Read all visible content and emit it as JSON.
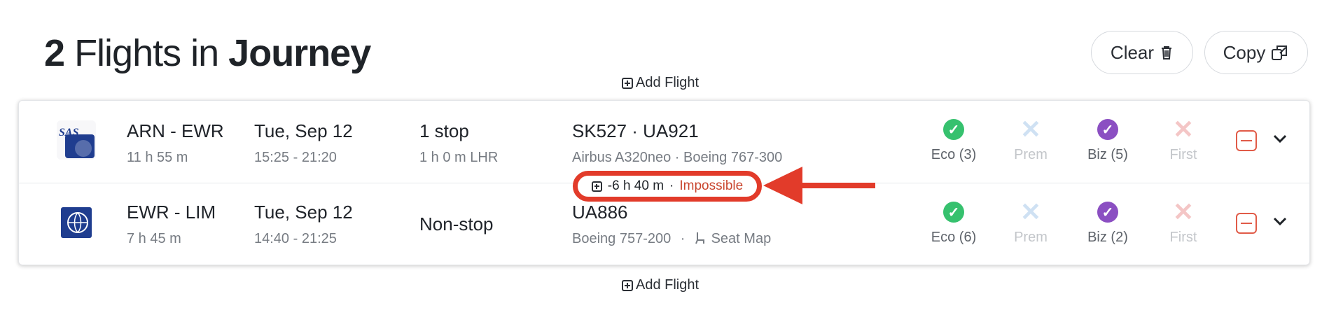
{
  "header": {
    "count": "2",
    "title_mid": "Flights in",
    "title_end": "Journey",
    "clear_label": "Clear",
    "copy_label": "Copy"
  },
  "add_flight_label": "Add Flight",
  "flights": [
    {
      "route": "ARN - EWR",
      "duration": "11 h 55 m",
      "date": "Tue, Sep 12",
      "times": "15:25 - 21:20",
      "stops": "1 stop",
      "stop_detail": "1 h 0 m  LHR",
      "flight_numbers": "SK527  ·  UA921",
      "aircraft": "Airbus A320neo  ·  Boeing 767-300",
      "fares": [
        {
          "label": "Eco (3)",
          "status": "available",
          "color": "#36c16e"
        },
        {
          "label": "Prem",
          "status": "unavailable",
          "color": "#cfe1f3"
        },
        {
          "label": "Biz (5)",
          "status": "available",
          "color": "#8b4fc2"
        },
        {
          "label": "First",
          "status": "unavailable",
          "color": "#f4c6c6"
        }
      ]
    },
    {
      "route": "EWR - LIM",
      "duration": "7 h 45 m",
      "date": "Tue, Sep 12",
      "times": "14:40 - 21:25",
      "stops": "Non-stop",
      "flight_numbers": "UA886",
      "aircraft": "Boeing 757-200",
      "seat_map": "Seat Map",
      "fares": [
        {
          "label": "Eco (6)",
          "status": "available",
          "color": "#36c16e"
        },
        {
          "label": "Prem",
          "status": "unavailable",
          "color": "#cfe1f3"
        },
        {
          "label": "Biz (2)",
          "status": "available",
          "color": "#8b4fc2"
        },
        {
          "label": "First",
          "status": "unavailable",
          "color": "#f4c6c6"
        }
      ]
    }
  ],
  "layover": {
    "time": "-6 h 40 m",
    "separator": "·",
    "status": "Impossible",
    "accent": "#e23b2a"
  },
  "icons": [
    "sas-logo-icon",
    "united-globe-icon",
    "trash-icon",
    "copy-icon",
    "plus-square-icon",
    "check-circle-icon",
    "x-icon",
    "minus-square-icon",
    "chevron-down-icon",
    "seat-icon",
    "arrow-left-icon"
  ]
}
